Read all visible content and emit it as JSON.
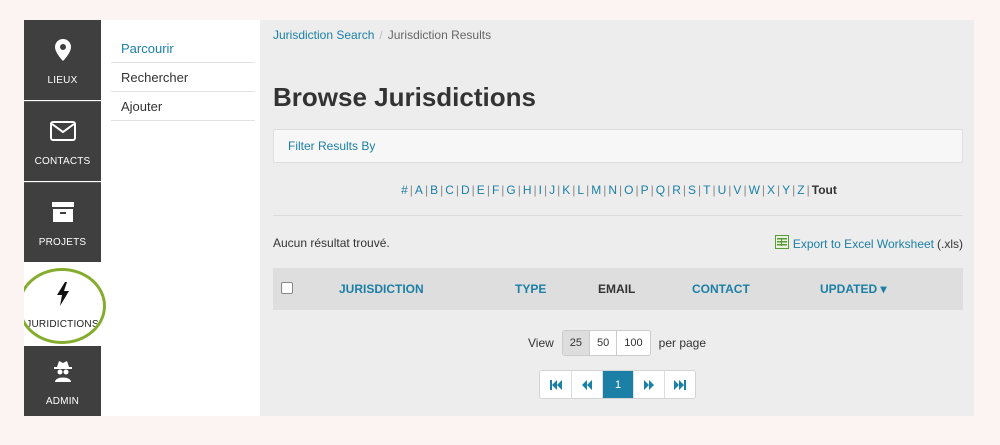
{
  "sidebar": {
    "items": [
      {
        "label": "LIEUX",
        "icon": "map-pin-icon"
      },
      {
        "label": "CONTACTS",
        "icon": "envelope-icon"
      },
      {
        "label": "PROJETS",
        "icon": "archive-box-icon"
      },
      {
        "label": "JURIDICTIONS",
        "icon": "lightning-bolt-icon"
      },
      {
        "label": "ADMIN",
        "icon": "spy-icon"
      }
    ]
  },
  "subnav": {
    "items": [
      {
        "label": "Parcourir"
      },
      {
        "label": "Rechercher"
      },
      {
        "label": "Ajouter"
      }
    ]
  },
  "breadcrumb": {
    "link": "Jurisdiction Search",
    "separator": "/",
    "current": "Jurisdiction Results"
  },
  "page": {
    "title": "Browse Jurisdictions",
    "filter_label": "Filter Results By",
    "alphabet": [
      "#",
      "A",
      "B",
      "C",
      "D",
      "E",
      "F",
      "G",
      "H",
      "I",
      "J",
      "K",
      "L",
      "M",
      "N",
      "O",
      "P",
      "Q",
      "R",
      "S",
      "T",
      "U",
      "V",
      "W",
      "X",
      "Y",
      "Z"
    ],
    "alphabet_all": "Tout",
    "no_results": "Aucun résultat trouvé.",
    "export_label": "Export to Excel Worksheet",
    "export_ext": "(.xls)"
  },
  "table": {
    "columns": [
      "JURISDICTION",
      "TYPE",
      "EMAIL",
      "CONTACT",
      "UPDATED"
    ],
    "sort_indicator": "▾"
  },
  "pagination": {
    "view_label": "View",
    "per_page_label": "per page",
    "per_page_options": [
      "25",
      "50",
      "100"
    ],
    "selected_per_page": "25",
    "current_page": "1"
  },
  "colors": {
    "accent": "#1b7fa6",
    "highlight_ring": "#84ad2d",
    "rail_bg": "#3f3f3f"
  }
}
